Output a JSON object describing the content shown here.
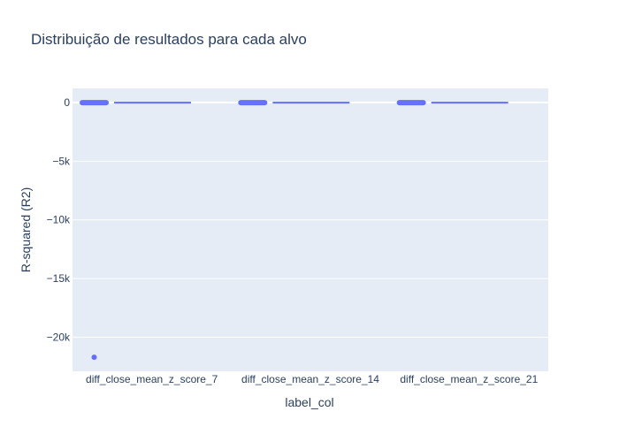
{
  "chart_data": {
    "type": "box",
    "title": "Distribuição de resultados para cada alvo",
    "xlabel": "label_col",
    "ylabel": "R-squared (R2)",
    "categories": [
      "diff_close_mean_z_score_7",
      "diff_close_mean_z_score_14",
      "diff_close_mean_z_score_21"
    ],
    "ylim": [
      -22900,
      1200
    ],
    "yticks": [
      0,
      -5000,
      -10000,
      -15000,
      -20000
    ],
    "ytick_labels": [
      "0",
      "−5k",
      "−10k",
      "−15k",
      "−20k"
    ],
    "grid": true,
    "series_color": "#636efa",
    "boxes": [
      {
        "category": "diff_close_mean_z_score_7",
        "q1": -40,
        "median": -15,
        "q3": 5,
        "lowerfence": -70,
        "upperfence": 40,
        "outliers": [
          -21700
        ]
      },
      {
        "category": "diff_close_mean_z_score_14",
        "q1": -40,
        "median": -15,
        "q3": 5,
        "lowerfence": -70,
        "upperfence": 40,
        "outliers": []
      },
      {
        "category": "diff_close_mean_z_score_21",
        "q1": -40,
        "median": -15,
        "q3": 5,
        "lowerfence": -70,
        "upperfence": 40,
        "outliers": []
      }
    ]
  },
  "colors": {
    "plot_bg": "#e5ecf6",
    "grid": "#ffffff",
    "text": "#2a3f5f"
  }
}
